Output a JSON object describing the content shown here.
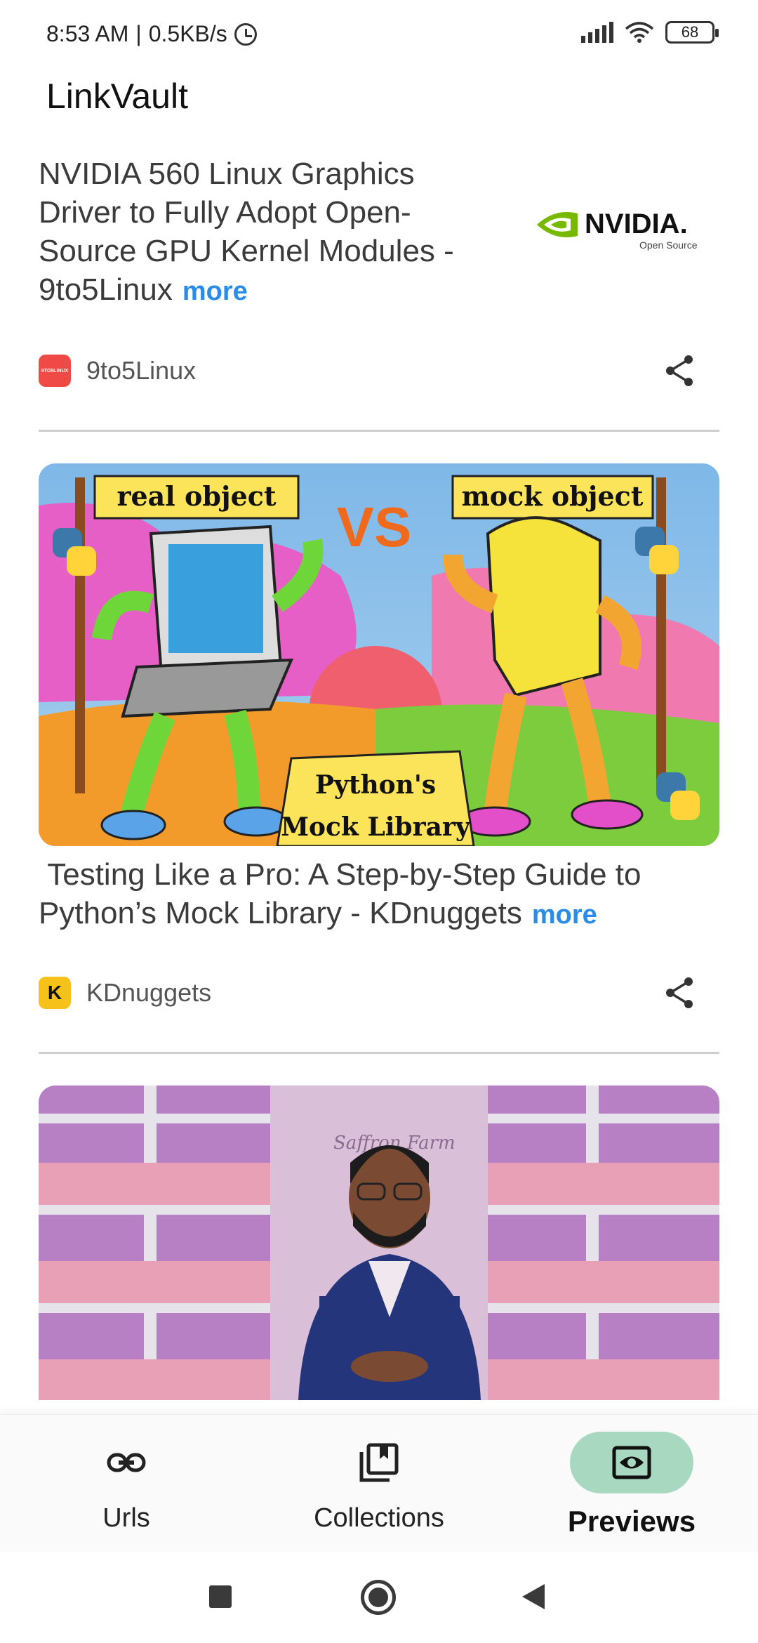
{
  "status_bar": {
    "time": "8:53 AM",
    "separator": "|",
    "speed": "0.5KB/s",
    "battery": "68"
  },
  "app": {
    "title": "LinkVault"
  },
  "cards": [
    {
      "title": "NVIDIA 560 Linux Graphics Driver to Fully Adopt Open-Source GPU Kernel Modules - 9to5Linux",
      "more": "more",
      "source": "9to5Linux",
      "source_icon_text": "9TO5LINUX",
      "logo_word": "NVIDIA.",
      "logo_sub": "Open Source"
    },
    {
      "title": " Testing Like a Pro: A Step-by-Step Guide to Python’s Mock Library - KDnuggets",
      "more": "more",
      "source": "KDnuggets",
      "source_icon_text": "K",
      "image_text": {
        "left_sign": "real object",
        "vs": "VS",
        "right_sign": "mock object",
        "banner_line1": "Python's",
        "banner_line2": "Mock Library"
      }
    },
    {
      "image_text": {
        "sign": "Saffron Farm"
      }
    }
  ],
  "bottom_nav": {
    "items": [
      {
        "label": "Urls",
        "icon": "link-icon",
        "active": false
      },
      {
        "label": "Collections",
        "icon": "collections-icon",
        "active": false
      },
      {
        "label": "Previews",
        "icon": "preview-eye-icon",
        "active": true
      }
    ]
  },
  "colors": {
    "accent_link": "#2b8ce6",
    "active_pill": "#a8d8bf",
    "divider": "#cfcfcf"
  }
}
